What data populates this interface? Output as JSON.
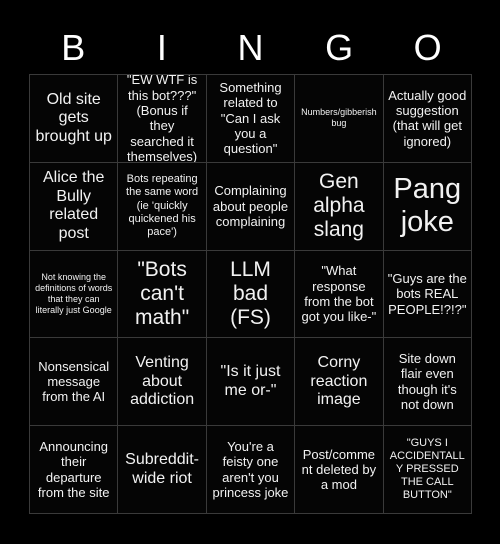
{
  "card": {
    "title": "BINGO",
    "background_color": "#000000",
    "text_color": "#ffffff",
    "border_color": "#3a3a3a"
  },
  "header": {
    "letters": [
      "B",
      "I",
      "N",
      "G",
      "O"
    ]
  },
  "grid": {
    "rows": 5,
    "columns": 5,
    "cells": [
      {
        "text": "Old site gets brought up",
        "size": "lg"
      },
      {
        "text": "\"EW WTF is this bot???\" (Bonus if they searched it themselves)",
        "size": "md"
      },
      {
        "text": "Something related to \"Can I ask you a question\"",
        "size": "md"
      },
      {
        "text": "Numbers/gibberish bug",
        "size": "xs"
      },
      {
        "text": "Actually good suggestion (that will get ignored)",
        "size": "md"
      },
      {
        "text": "Alice the Bully related post",
        "size": "lg"
      },
      {
        "text": "Bots repeating the same word (ie 'quickly quickened his pace')",
        "size": "sm"
      },
      {
        "text": "Complaining about people complaining",
        "size": "md"
      },
      {
        "text": "Gen alpha slang",
        "size": "xl"
      },
      {
        "text": "Pang joke",
        "size": "xxl"
      },
      {
        "text": "Not knowing the definitions of words that they can literally just Google",
        "size": "xs"
      },
      {
        "text": "\"Bots can't math\"",
        "size": "xl"
      },
      {
        "text": "LLM bad (FS)",
        "size": "xl"
      },
      {
        "text": "\"What response from the bot got you like-\"",
        "size": "md"
      },
      {
        "text": "\"Guys are the bots REAL PEOPLE!?!?\"",
        "size": "md"
      },
      {
        "text": "Nonsensical message from the AI",
        "size": "md"
      },
      {
        "text": "Venting about addiction",
        "size": "lg"
      },
      {
        "text": "\"Is it just me or-\"",
        "size": "lg"
      },
      {
        "text": "Corny reaction image",
        "size": "lg"
      },
      {
        "text": "Site down flair even though it's not down",
        "size": "md"
      },
      {
        "text": "Announcing their departure from the site",
        "size": "md"
      },
      {
        "text": "Subreddit-wide riot",
        "size": "lg"
      },
      {
        "text": "You're a feisty one aren't you princess joke",
        "size": "md"
      },
      {
        "text": "Post/comment deleted by a mod",
        "size": "md"
      },
      {
        "text": "\"GUYS I ACCIDENTALLY PRESSED THE CALL BUTTON\"",
        "size": "sm"
      }
    ]
  }
}
